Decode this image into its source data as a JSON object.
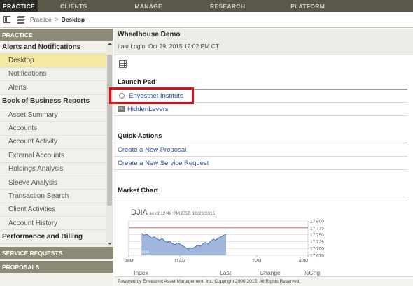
{
  "nav": {
    "tabs": [
      {
        "label": "PRACTICE"
      },
      {
        "label": "CLIENTS"
      },
      {
        "label": "MANAGE"
      },
      {
        "label": "RESEARCH"
      },
      {
        "label": "PLATFORM"
      }
    ]
  },
  "breadcrumb": {
    "parent": "Practice",
    "separator": ">",
    "current": "Desktop"
  },
  "sidebar": {
    "top_section": "PRACTICE",
    "groups": [
      {
        "heading": "Alerts and Notifications",
        "items": [
          "Desktop",
          "Notifications",
          "Alerts"
        ]
      },
      {
        "heading": "Book of Business Reports",
        "items": [
          "Asset Summary",
          "Accounts",
          "Account Activity",
          "External Accounts",
          "Holdings Analysis",
          "Sleeve Analysis",
          "Transaction Search",
          "Client Activities",
          "Account History"
        ]
      },
      {
        "heading": "Performance and Billing",
        "items": []
      }
    ],
    "active_item": "Desktop",
    "bottom_sections": [
      "SERVICE REQUESTS",
      "PROPOSALS"
    ]
  },
  "main": {
    "title": "Wheelhouse Demo",
    "last_login": "Last Login: Oct 29, 2015 12:02 PM CT",
    "launch_pad": {
      "title": "Launch Pad",
      "links": [
        {
          "label": "Envestnet Institute",
          "icon": "globe-icon"
        },
        {
          "label": "HiddenLevers",
          "icon": "hiddenlevers-icon"
        }
      ]
    },
    "quick_actions": {
      "title": "Quick Actions",
      "links": [
        "Create a New Proposal",
        "Create a New Service Request"
      ]
    },
    "market_chart": {
      "title": "Market Chart"
    },
    "footer": "Powered by Envestnet Asset Management, Inc. Copyright 2000-2015. All Rights Reserved."
  },
  "chart_data": {
    "type": "area",
    "title": "DJIA",
    "subtitle": "as of 12:48 PM EDT, 10/29/2015",
    "interval_label": "1 Minute",
    "x_ticks": [
      "9AM",
      "11AM",
      "2PM",
      "4PM"
    ],
    "y_ticks": [
      17800,
      17775,
      17750,
      17725,
      17700,
      17675
    ],
    "y_tick_labels": [
      "17,800",
      "17,775",
      "17,750",
      "17,725",
      "17,700",
      "17,675"
    ],
    "ylim": [
      17675,
      17800
    ],
    "reference_line": 17775,
    "x_hours": [
      9.5,
      9.6,
      9.7,
      9.8,
      9.9,
      10.0,
      10.1,
      10.2,
      10.3,
      10.4,
      10.5,
      10.6,
      10.7,
      10.8,
      10.9,
      11.0,
      11.1,
      11.2,
      11.3,
      11.4,
      11.5,
      11.6,
      11.7,
      11.8,
      11.9,
      12.0,
      12.1,
      12.2,
      12.3,
      12.4,
      12.5,
      12.6,
      12.7,
      12.8
    ],
    "values": [
      17755,
      17748,
      17752,
      17745,
      17738,
      17742,
      17735,
      17730,
      17736,
      17728,
      17722,
      17726,
      17718,
      17714,
      17720,
      17716,
      17710,
      17704,
      17698,
      17702,
      17700,
      17706,
      17712,
      17708,
      17718,
      17722,
      17716,
      17726,
      17734,
      17730,
      17738,
      17742,
      17748,
      17752
    ],
    "table_headers": [
      "Index",
      "Last",
      "Change",
      "%Chg"
    ]
  }
}
